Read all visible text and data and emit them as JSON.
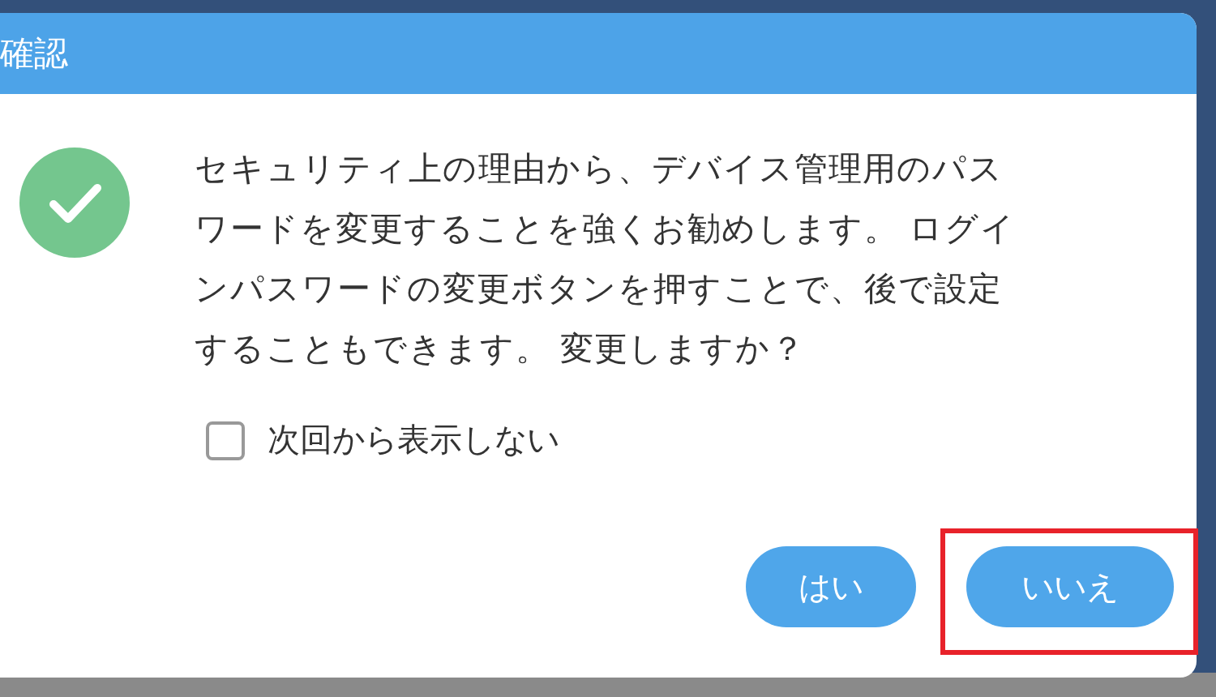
{
  "dialog": {
    "title": "確認",
    "message": "セキュリティ上の理由から、デバイス管理用のパスワードを変更することを強くお勧めします。 ログインパスワードの変更ボタンを押すことで、後で設定することもできます。 変更しますか？",
    "checkbox": {
      "label": "次回から表示しない",
      "checked": false
    },
    "buttons": [
      {
        "label": "はい",
        "highlighted": false
      },
      {
        "label": "いいえ",
        "highlighted": true
      }
    ]
  }
}
